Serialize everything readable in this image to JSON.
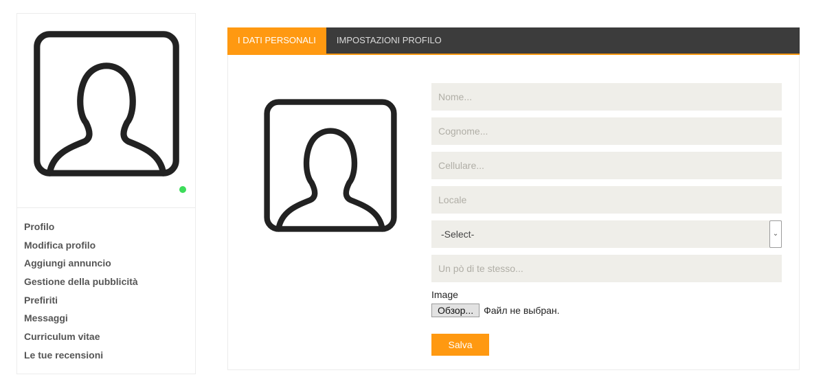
{
  "sidebar": {
    "avatar_icon": "user-silhouette-icon",
    "status_color": "#3ddc5a",
    "menu": [
      {
        "label": "Profilo"
      },
      {
        "label": "Modifica profilo"
      },
      {
        "label": "Aggiungi annuncio"
      },
      {
        "label": "Gestione della pubblicità"
      },
      {
        "label": "Prefiriti"
      },
      {
        "label": "Messaggi"
      },
      {
        "label": "Curriculum vitae"
      },
      {
        "label": "Le tue recensioni"
      }
    ]
  },
  "tabs": [
    {
      "label": "I DATI PERSONALI",
      "active": true
    },
    {
      "label": "IMPOSTAZIONI PROFILO",
      "active": false
    }
  ],
  "form": {
    "name_placeholder": "Nome...",
    "surname_placeholder": "Cognome...",
    "phone_placeholder": "Cellulare...",
    "locale_placeholder": "Locale",
    "select_value": "-Select-",
    "about_placeholder": "Un pò di te stesso...",
    "image_label": "Image",
    "file_button": "Обзор...",
    "file_status": "Файл не выбран.",
    "save_label": "Salva"
  },
  "colors": {
    "accent": "#ff9911",
    "tabbar": "#3c3c3c",
    "field_bg": "#efeee9"
  }
}
